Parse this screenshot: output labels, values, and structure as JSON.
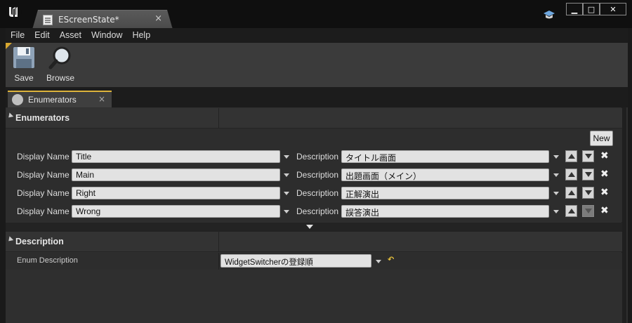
{
  "window": {
    "tab_title": "EScreenState*",
    "tab_close": "×",
    "minimize": "▁",
    "maximize": "□",
    "close": "✕"
  },
  "menu": {
    "items": [
      "File",
      "Edit",
      "Asset",
      "Window",
      "Help"
    ]
  },
  "toolbar": {
    "save_label": "Save",
    "browse_label": "Browse"
  },
  "panel_tab": {
    "label": "Enumerators",
    "close": "×"
  },
  "enumerators": {
    "section_title": "Enumerators",
    "new_button": "New",
    "display_name_label": "Display Name",
    "description_label": "Description",
    "rows": [
      {
        "display_name": "Title",
        "description": "タイトル画面"
      },
      {
        "display_name": "Main",
        "description": "出題画面（メイン）"
      },
      {
        "display_name": "Right",
        "description": "正解演出"
      },
      {
        "display_name": "Wrong",
        "description": "誤答演出"
      }
    ]
  },
  "description_section": {
    "section_title": "Description",
    "label": "Enum Description",
    "value": "WidgetSwitcherの登録順"
  },
  "colors": {
    "accent": "#ddb33b",
    "panel_bg": "#2f2f2f",
    "titlebar_bg": "#0f0f0f"
  }
}
